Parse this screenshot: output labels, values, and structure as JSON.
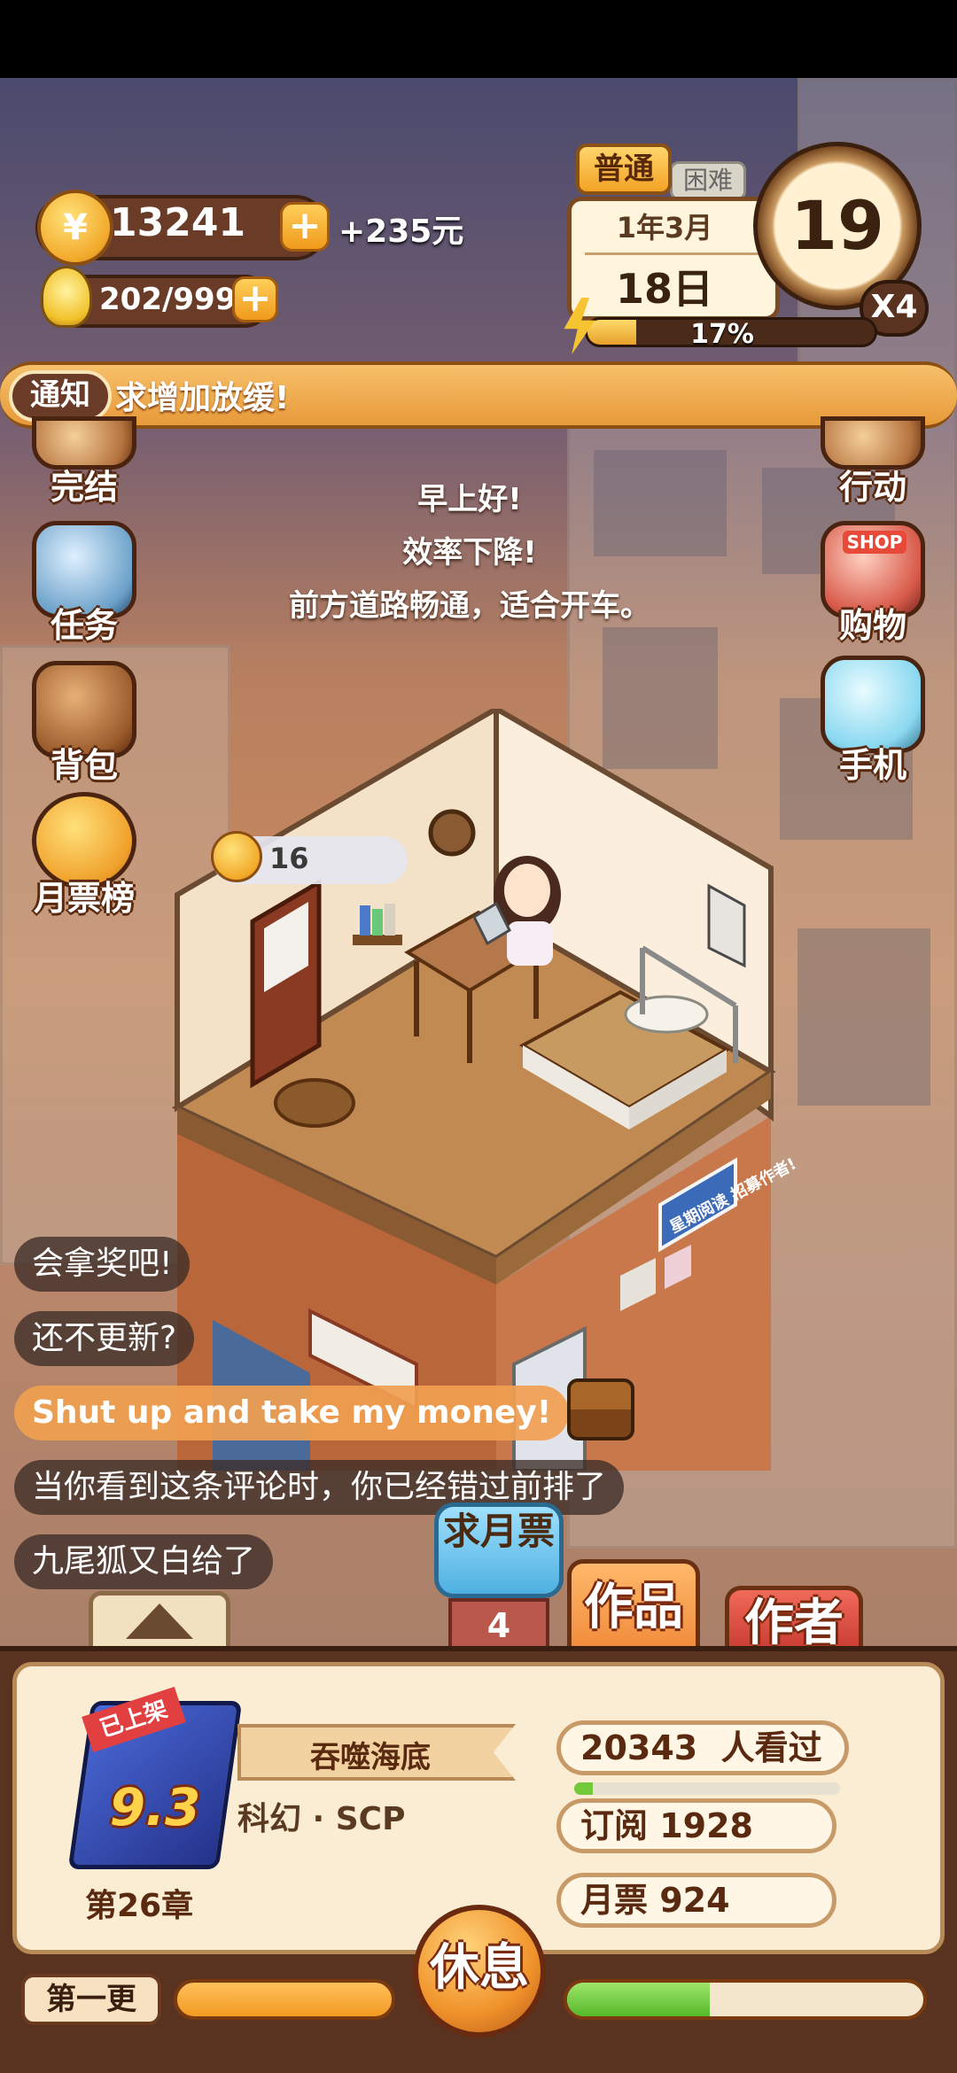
{
  "hud": {
    "coins": "13241",
    "plus": "+",
    "yuan": "+235元",
    "inspiration": "202/999",
    "mode_active": "普通",
    "mode_other": "困难",
    "date_month": "1年3月",
    "date_day": "18日",
    "clock_value": "19",
    "speed": "X4",
    "energy_percent": 17,
    "energy_label": "17%"
  },
  "notice": {
    "tag": "通知",
    "text": "求增加放缓!"
  },
  "left_menu": [
    {
      "label": "完结",
      "icon": "book-icon"
    },
    {
      "label": "任务",
      "icon": "clipboard-icon"
    },
    {
      "label": "背包",
      "icon": "bag-icon"
    },
    {
      "label": "月票榜",
      "icon": "medal-icon"
    }
  ],
  "right_menu": [
    {
      "label": "行动",
      "icon": "door-icon"
    },
    {
      "label": "购物",
      "icon": "shop-icon"
    },
    {
      "label": "手机",
      "icon": "phone-icon"
    }
  ],
  "shop_sign": "SHOP",
  "greeting": [
    "早上好!",
    "效率下降!",
    "前方道路畅通，适合开车。"
  ],
  "room_coin_count": "16",
  "poster": "星期阅读 招募作者!",
  "chat": [
    "会拿奖吧!",
    "还不更新?",
    "Shut up and take my money!",
    "当你看到这条评论时，你已经错过前排了",
    "九尾狐又白给了"
  ],
  "monthly_ticket_button": "求月票",
  "monthly_ticket_count": "4",
  "tabs": {
    "works": "作品",
    "author": "作者"
  },
  "book": {
    "status_tag": "已上架",
    "score": "9.3",
    "title": "吞噬海底",
    "genre": "科幻 · SCP",
    "chapter": "第26章",
    "viewers": "20343  人看过",
    "subscriptions": "订阅 1928",
    "monthly_tickets": "月票 924",
    "viewer_progress": 0.07
  },
  "bottom": {
    "first_update": "第一更",
    "rest_button": "休息",
    "right_progress": 0.4
  }
}
